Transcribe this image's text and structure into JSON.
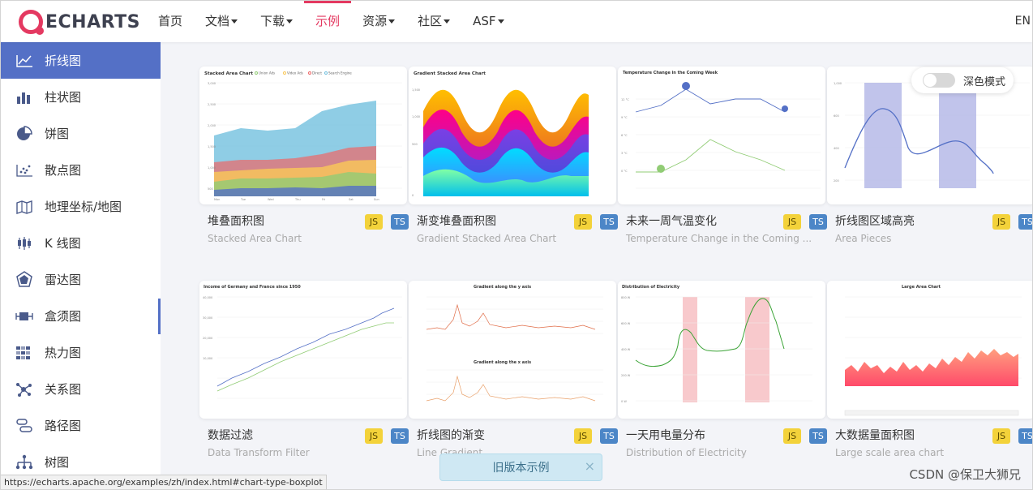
{
  "header": {
    "logo_text": "ECHARTS",
    "nav": [
      {
        "label": "首页",
        "caret": false,
        "active": false
      },
      {
        "label": "文档",
        "caret": true,
        "active": false
      },
      {
        "label": "下载",
        "caret": true,
        "active": false
      },
      {
        "label": "示例",
        "caret": false,
        "active": true
      },
      {
        "label": "资源",
        "caret": true,
        "active": false
      },
      {
        "label": "社区",
        "caret": true,
        "active": false
      },
      {
        "label": "ASF",
        "caret": true,
        "active": false
      }
    ],
    "lang": "EN"
  },
  "sidebar": {
    "items": [
      {
        "label": "折线图",
        "icon": "line-chart-icon",
        "active": true
      },
      {
        "label": "柱状图",
        "icon": "bar-chart-icon",
        "active": false
      },
      {
        "label": "饼图",
        "icon": "pie-chart-icon",
        "active": false
      },
      {
        "label": "散点图",
        "icon": "scatter-chart-icon",
        "active": false
      },
      {
        "label": "地理坐标/地图",
        "icon": "map-icon",
        "active": false
      },
      {
        "label": "K 线图",
        "icon": "candlestick-icon",
        "active": false
      },
      {
        "label": "雷达图",
        "icon": "radar-icon",
        "active": false
      },
      {
        "label": "盒须图",
        "icon": "boxplot-icon",
        "active": false
      },
      {
        "label": "热力图",
        "icon": "heatmap-icon",
        "active": false
      },
      {
        "label": "关系图",
        "icon": "graph-icon",
        "active": false
      },
      {
        "label": "路径图",
        "icon": "lines-icon",
        "active": false
      },
      {
        "label": "树图",
        "icon": "tree-icon",
        "active": false
      }
    ]
  },
  "dark_mode": {
    "label": "深色模式",
    "enabled": false
  },
  "cards": [
    {
      "title": "堆叠面积图",
      "subtitle": "Stacked Area Chart",
      "thumb_title": "Stacked Area Chart",
      "js": "JS",
      "ts": "TS"
    },
    {
      "title": "渐变堆叠面积图",
      "subtitle": "Gradient Stacked Area Chart",
      "thumb_title": "Gradient Stacked Area Chart",
      "js": "JS",
      "ts": "TS"
    },
    {
      "title": "未来一周气温变化",
      "subtitle": "Temperature Change in the Coming ...",
      "thumb_title": "Temperature Change in the Coming Week",
      "js": "JS",
      "ts": "TS"
    },
    {
      "title": "折线图区域高亮",
      "subtitle": "Area Pieces",
      "thumb_title": "",
      "js": "JS",
      "ts": "TS"
    },
    {
      "title": "数据过滤",
      "subtitle": "Data Transform Filter",
      "thumb_title": "Income of Germany and France since 1950",
      "js": "JS",
      "ts": "TS"
    },
    {
      "title": "折线图的渐变",
      "subtitle": "Line Gradient",
      "thumb_title": "Gradient along the y axis",
      "thumb_title2": "Gradient along the x axis",
      "js": "JS",
      "ts": "TS"
    },
    {
      "title": "一天用电量分布",
      "subtitle": "Distribution of Electricity",
      "thumb_title": "Distribution of Electricity",
      "js": "JS",
      "ts": "TS"
    },
    {
      "title": "大数据量面积图",
      "subtitle": "Large scale area chart",
      "thumb_title": "Large Area Chart",
      "js": "JS",
      "ts": "TS"
    }
  ],
  "old_examples": {
    "label": "旧版本示例",
    "close": "×"
  },
  "status_url": "https://echarts.apache.org/examples/zh/index.html#chart-type-boxplot",
  "watermark": "CSDN @保卫大狮兄",
  "colors": {
    "accent": "#e43961",
    "sidebar_active": "#5470c6",
    "js_badge": "#f3d23a",
    "ts_badge": "#4c86c7"
  }
}
